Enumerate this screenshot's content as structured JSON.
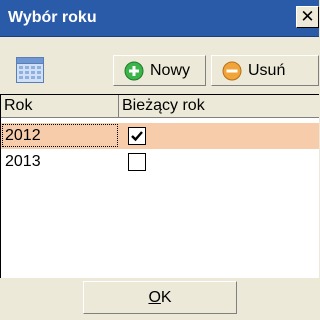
{
  "window": {
    "title": "Wybór roku",
    "close_label": "✕"
  },
  "toolbar": {
    "calendar_icon": "calendar-icon",
    "new_label": "Nowy",
    "new_icon": "plus-circle-icon",
    "delete_label": "Usuń",
    "delete_icon": "minus-circle-icon"
  },
  "grid": {
    "columns": [
      "Rok",
      "Bieżący rok"
    ],
    "rows": [
      {
        "year": "2012",
        "current": true,
        "selected": true
      },
      {
        "year": "2013",
        "current": false,
        "selected": false
      }
    ]
  },
  "footer": {
    "ok_mnemonic": "O",
    "ok_rest": "K"
  },
  "colors": {
    "titlebar": "#2a5ba8",
    "window_bg": "#ece9d8",
    "selected_row": "#f6ccaa",
    "new_icon": "#3bb54a",
    "delete_icon": "#f0a43a"
  }
}
